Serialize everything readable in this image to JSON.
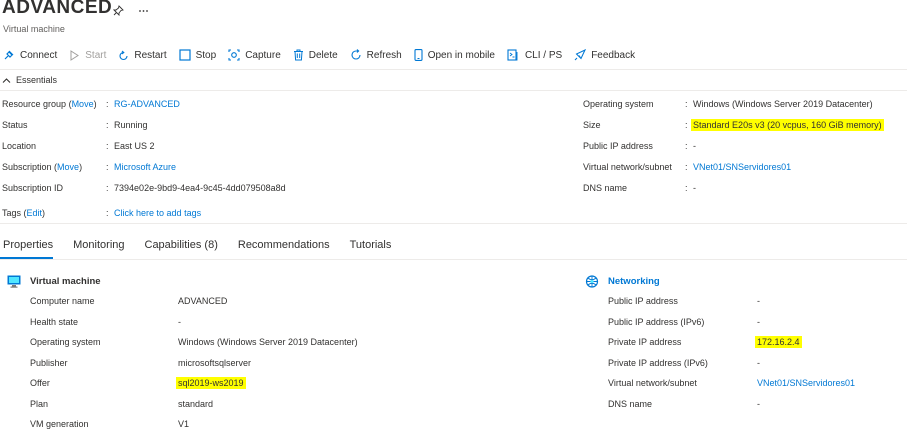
{
  "header": {
    "title": "ADVANCED",
    "subtitle": "Virtual machine",
    "pin_icon": "pin-icon",
    "more_icon": "ellipsis-icon"
  },
  "toolbar": {
    "connect": "Connect",
    "start": "Start",
    "restart": "Restart",
    "stop": "Stop",
    "capture": "Capture",
    "delete": "Delete",
    "refresh": "Refresh",
    "open_mobile": "Open in mobile",
    "cli": "CLI / PS",
    "feedback": "Feedback"
  },
  "essentials": {
    "header": "Essentials",
    "left": [
      {
        "label": "Resource group",
        "label_link": "Move",
        "value": "RG-ADVANCED",
        "value_is_link": true
      },
      {
        "label": "Status",
        "value": "Running"
      },
      {
        "label": "Location",
        "value": "East US 2"
      },
      {
        "label": "Subscription",
        "label_link": "Move",
        "value": "Microsoft Azure",
        "value_is_link": true
      },
      {
        "label": "Subscription ID",
        "value": "7394e02e-9bd9-4ea4-9c45-4dd079508a8d"
      }
    ],
    "right": [
      {
        "label": "Operating system",
        "value": "Windows (Windows Server 2019 Datacenter)"
      },
      {
        "label": "Size",
        "value": "Standard E20s v3 (20 vcpus, 160 GiB memory)",
        "highlighted": true
      },
      {
        "label": "Public IP address",
        "value": "-"
      },
      {
        "label": "Virtual network/subnet",
        "value": "VNet01/SNServidores01",
        "value_is_link": true
      },
      {
        "label": "DNS name",
        "value": "-"
      }
    ],
    "tags": {
      "label": "Tags",
      "edit": "Edit",
      "value": "Click here to add tags"
    },
    "separator": ":",
    "paren_open": "(",
    "paren_close": ")"
  },
  "tabs": [
    "Properties",
    "Monitoring",
    "Capabilities (8)",
    "Recommendations",
    "Tutorials"
  ],
  "active_tab": "Properties",
  "vm_section": {
    "title": "Virtual machine",
    "rows": [
      {
        "label": "Computer name",
        "value": "ADVANCED"
      },
      {
        "label": "Health state",
        "value": "-"
      },
      {
        "label": "Operating system",
        "value": "Windows (Windows Server 2019 Datacenter)"
      },
      {
        "label": "Publisher",
        "value": "microsoftsqlserver"
      },
      {
        "label": "Offer",
        "value": "sql2019-ws2019",
        "highlighted": true
      },
      {
        "label": "Plan",
        "value": "standard"
      },
      {
        "label": "VM generation",
        "value": "V1"
      }
    ]
  },
  "net_section": {
    "title": "Networking",
    "rows": [
      {
        "label": "Public IP address",
        "value": "-"
      },
      {
        "label": "Public IP address (IPv6)",
        "value": "-"
      },
      {
        "label": "Private IP address",
        "value": "172.16.2.4",
        "highlighted": true
      },
      {
        "label": "Private IP address (IPv6)",
        "value": "-"
      },
      {
        "label": "Virtual network/subnet",
        "value": "VNet01/SNServidores01",
        "value_is_link": true
      },
      {
        "label": "DNS name",
        "value": "-"
      }
    ]
  },
  "colors": {
    "accent": "#0078d4",
    "highlight": "#ffff00",
    "text": "#323130",
    "disabled": "#a19f9d"
  }
}
